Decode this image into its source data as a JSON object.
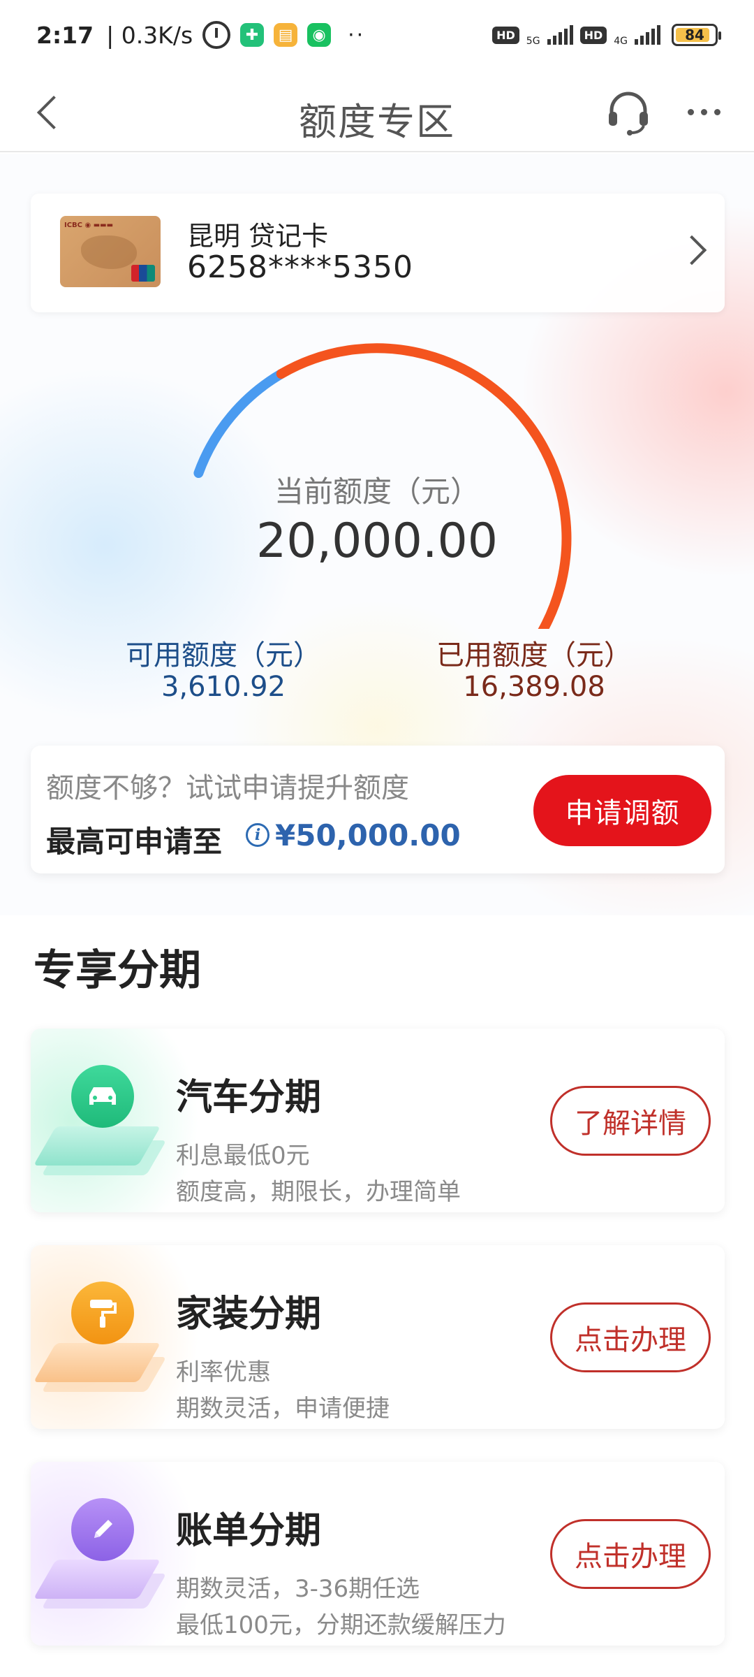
{
  "status_bar": {
    "time": "2:17",
    "speed": "| 0.3K/s",
    "net_1": "5G",
    "net_2": "4G",
    "hd": "HD",
    "battery": "84"
  },
  "header": {
    "title": "额度专区"
  },
  "card": {
    "name": "昆明 贷记卡",
    "number": "6258****5350"
  },
  "limit": {
    "current_label": "当前额度（元）",
    "current_value": "20,000.00",
    "available_label": "可用额度（元）",
    "available_value": "3,610.92",
    "used_label": "已用额度（元）",
    "used_value": "16,389.08",
    "used_fraction": 0.8195,
    "available_color": "#4a9bf0",
    "used_color": "#f4541e"
  },
  "upgrade": {
    "hint": "额度不够？试试申请提升额度",
    "max_label": "最高可申请至",
    "max_amount": "¥50,000.00",
    "button": "申请调额"
  },
  "section": {
    "title": "专享分期"
  },
  "plans": [
    {
      "title": "汽车分期",
      "desc1": "利息最低0元",
      "desc2": "额度高，期限长，办理简单",
      "button": "了解详情",
      "icon": "car-icon",
      "color": "#2fcf8e"
    },
    {
      "title": "家装分期",
      "desc1": "利率优惠",
      "desc2": "期数灵活，申请便捷",
      "button": "点击办理",
      "icon": "paint-roller-icon",
      "color": "#f7a11d"
    },
    {
      "title": "账单分期",
      "desc1": "期数灵活，3-36期任选",
      "desc2": "最低100元，分期还款缓解压力",
      "button": "点击办理",
      "icon": "pencil-icon",
      "color": "#a57cf0"
    }
  ]
}
